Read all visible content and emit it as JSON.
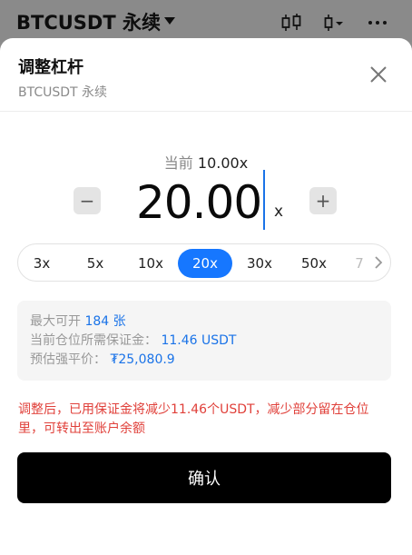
{
  "header": {
    "symbol": "BTCUSDT 永续"
  },
  "dialog": {
    "title": "调整杠杆",
    "subtitle": "BTCUSDT 永续",
    "current_label": "当前",
    "current_value": "10.00x",
    "leverage_value": "20.00",
    "unit": "x",
    "minus_label": "−",
    "plus_label": "+",
    "presets": [
      {
        "label": "3x"
      },
      {
        "label": "5x"
      },
      {
        "label": "10x"
      },
      {
        "label": "20x"
      },
      {
        "label": "30x"
      },
      {
        "label": "50x"
      },
      {
        "label": "7"
      }
    ],
    "selected_preset": "20x",
    "info": {
      "max_open_label": "最大可开",
      "max_open_value": "184 张",
      "margin_label": "当前仓位所需保证金：",
      "margin_value": "11.46 USDT",
      "liq_label": "预估强平价：",
      "liq_value": "₮25,080.9"
    },
    "warning": "调整后，已用保证金将减少11.46个USDT，减少部分留在仓位里，可转出至账户余额",
    "confirm_label": "确认"
  },
  "colors": {
    "accent": "#1677ff",
    "link": "#1a73e8",
    "warning": "#e0403a",
    "button": "#000000"
  },
  "icons": [
    "chevron-down-icon",
    "candlestick-icon",
    "indicator-icon",
    "more-icon",
    "close-icon",
    "chevron-right-icon"
  ]
}
